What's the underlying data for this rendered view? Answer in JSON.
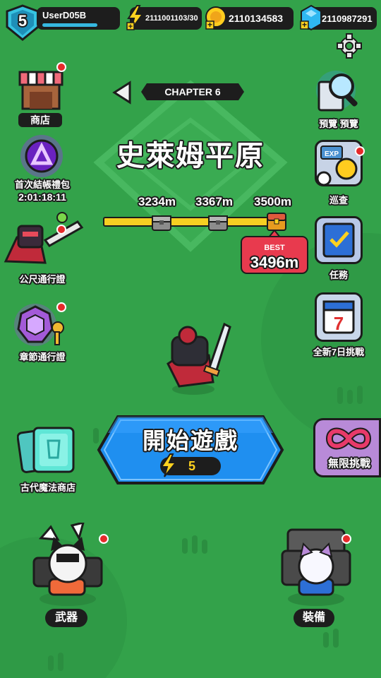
{
  "player": {
    "level": "5",
    "name": "UserD05B"
  },
  "resources": {
    "energy": "2111001103/30",
    "coins": "2110134583",
    "gems": "2110987291"
  },
  "chapter": {
    "label": "CHAPTER 6",
    "stage_name": "史萊姆平原"
  },
  "progress": {
    "milestones": [
      "3234m",
      "3367m",
      "3500m"
    ],
    "best_label": "BEST",
    "best_value": "3496m"
  },
  "left_menu": {
    "shop": "商店",
    "first_pack": "首次結帳禮包",
    "first_pack_timer": "2:01:18:11",
    "ruler_pass": "公尺通行證",
    "chapter_pass": "章節通行證",
    "ancient_shop": "古代魔法商店"
  },
  "right_menu": {
    "preview": "預覽 預覽",
    "patrol": "巡查",
    "mission": "任務",
    "seven_day": "全新7日挑戰",
    "endless": "無限挑戰"
  },
  "start": {
    "label": "開始遊戲",
    "cost": "5"
  },
  "bottom": {
    "weapon": "武器",
    "equipment": "裝備"
  },
  "colors": {
    "background": "#33a24a",
    "start_button": "#1f8ff0",
    "best_badge": "#e83a4e",
    "progress": "#f6cf22"
  }
}
